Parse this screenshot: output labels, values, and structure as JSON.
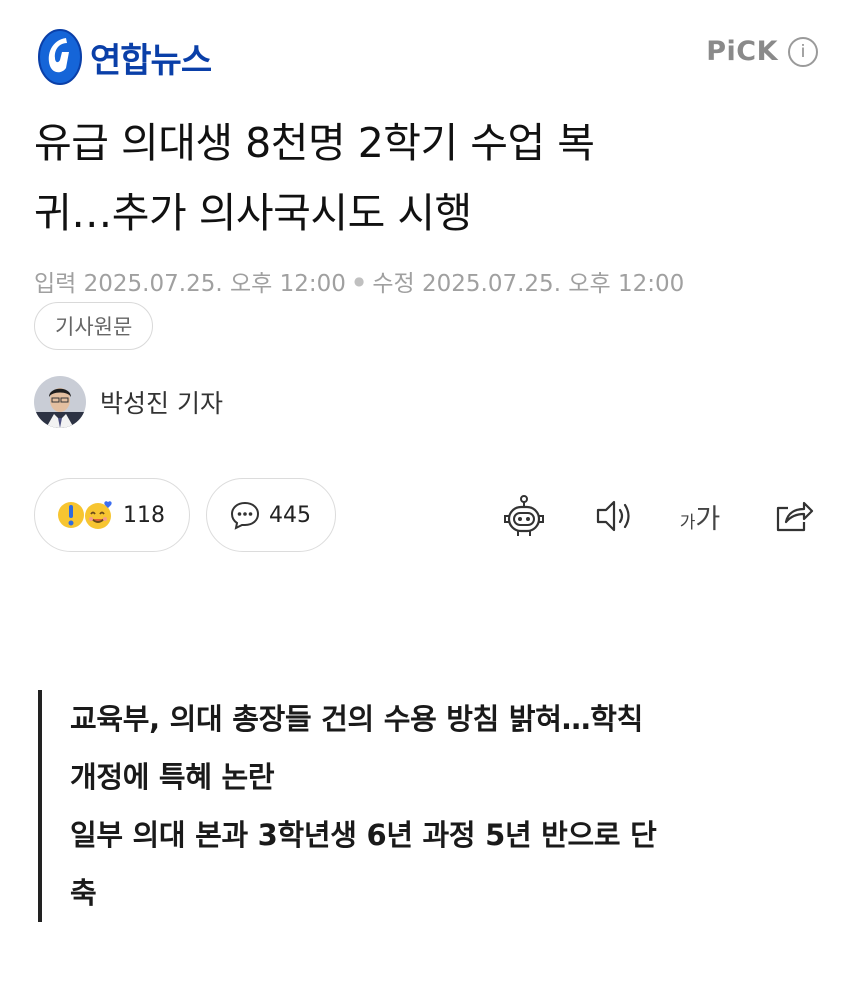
{
  "header": {
    "logo_text": "연합뉴스",
    "pick_label": "PiCK",
    "info_glyph": "i"
  },
  "article": {
    "title_line1": "유급 의대생 8천명 2학기 수업 복",
    "title_line2": "귀…추가 의사국시도 시행",
    "input_label": "입력",
    "input_time": "2025.07.25. 오후 12:00",
    "modified_label": "수정",
    "modified_time": "2025.07.25. 오후 12:00",
    "original_button": "기사원문",
    "reporter": "박성진 기자"
  },
  "actions": {
    "reactions_count": "118",
    "comments_count": "445",
    "font_small": "가",
    "font_large": "가"
  },
  "summary": {
    "line1": "교육부, 의대 총장들 건의 수용 방침 밝혀…학칙",
    "line2": "개정에 특혜 논란",
    "line3": "일부 의대 본과 3학년생 6년 과정 5년 반으로 단",
    "line4": "축"
  },
  "colors": {
    "brand": "#0a3fa8",
    "meta": "#a0a0a0",
    "summary_bar": "#222222"
  },
  "icons": [
    "yonhap-logo-icon",
    "info-icon",
    "surprise-emoji-icon",
    "love-emoji-icon",
    "comment-icon",
    "robot-icon",
    "speaker-icon",
    "font-size-icon",
    "share-icon"
  ]
}
